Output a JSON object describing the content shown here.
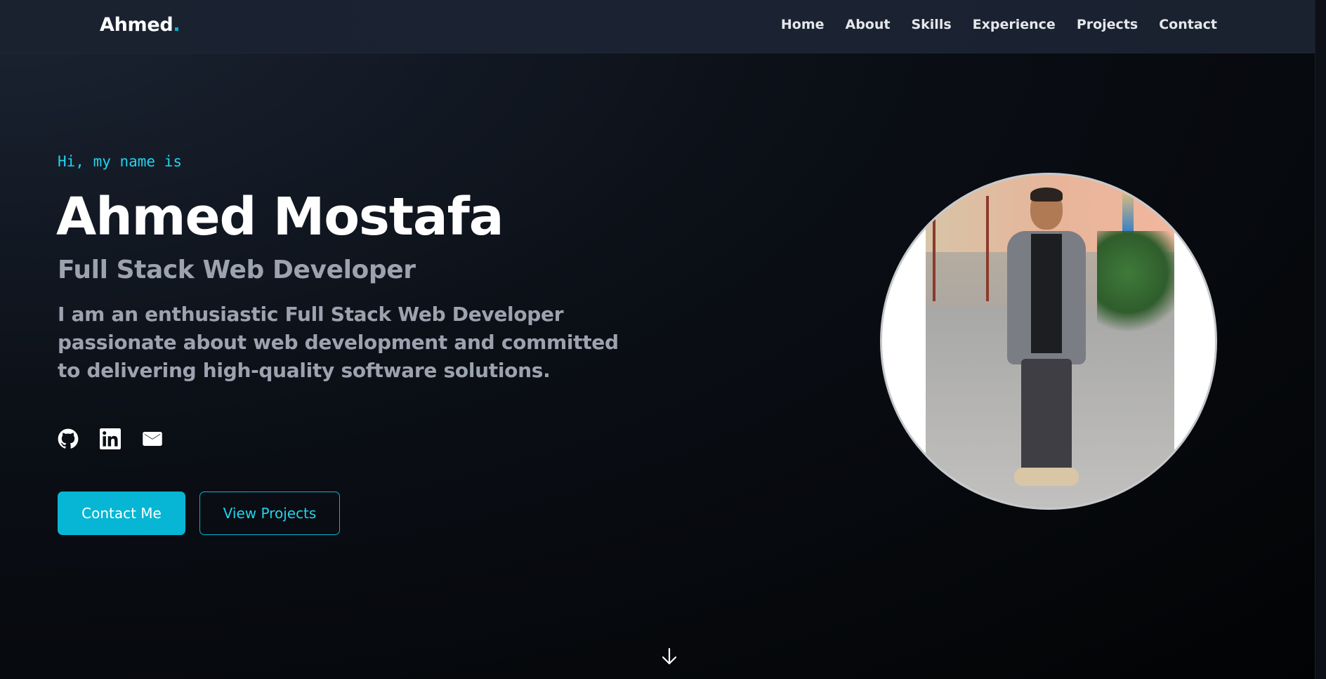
{
  "nav": {
    "brand_name": "Ahmed",
    "brand_dot": ".",
    "links": [
      "Home",
      "About",
      "Skills",
      "Experience",
      "Projects",
      "Contact"
    ]
  },
  "hero": {
    "greeting": "Hi, my name is",
    "name": "Ahmed Mostafa",
    "role": "Full Stack Web Developer",
    "description": "I am an enthusiastic Full Stack Web Developer passionate about web development and committed to delivering high-quality software solutions.",
    "socials": [
      {
        "icon": "github-icon"
      },
      {
        "icon": "linkedin-icon"
      },
      {
        "icon": "mail-icon"
      }
    ],
    "primary_button": "Contact Me",
    "secondary_button": "View Projects",
    "scroll_icon": "arrow-down-icon"
  },
  "colors": {
    "accent": "#06b6d4",
    "accent_text": "#22d3ee",
    "muted_text": "#9ca3af",
    "background": "#0b0f16",
    "nav_background": "#1b2332"
  }
}
